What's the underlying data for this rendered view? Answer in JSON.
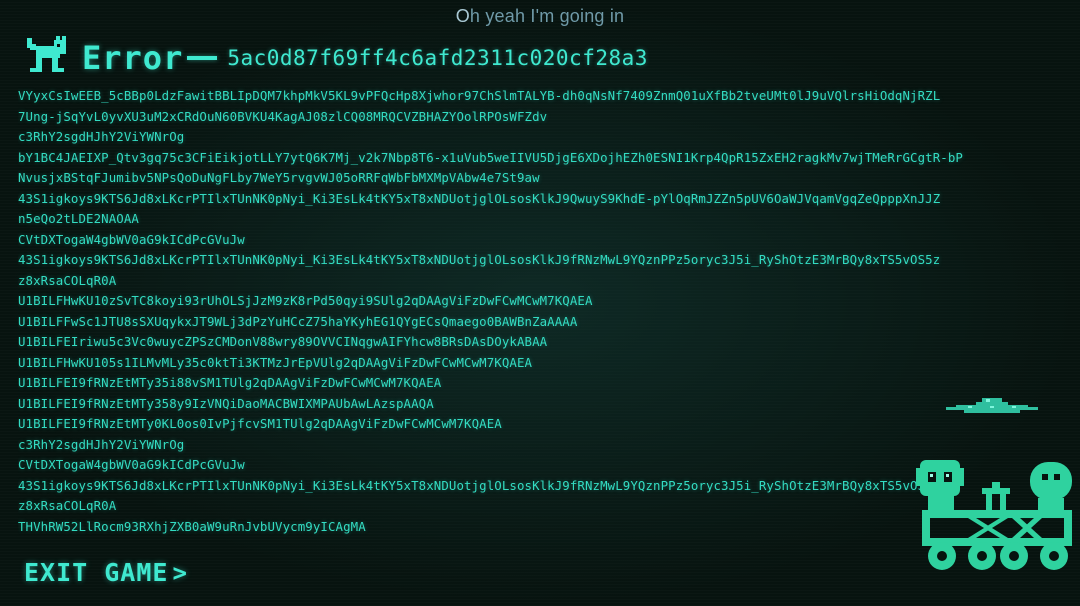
{
  "subtitle": {
    "first_letter": "O",
    "rest": "h yeah I'm going in"
  },
  "error": {
    "title": "Error",
    "hash": "5ac0d87f69ff4c6afd2311c020cf28a3"
  },
  "log_lines": [
    "VYyxCsIwEEB_5cBBp0LdzFawitBBLIpDQM7khpMkV5KL9vPFQcHp8Xjwhor97ChSlmTALYB-dh0qNsNf7409ZnmQ01uXfBb2tveUMt0lJ9uVQlrsHiOdqNjRZL",
    "7Ung-jSqYvL0yvXU3uM2xCRdOuN60BVKU4KagAJ08zlCQ08MRQCVZBHAZYOolRPOsWFZdv",
    "c3RhY2sgdHJhY2ViYWNrOg",
    "bY1BC4JAEIXP_Qtv3gq75c3CFiEikjotLLY7ytQ6K7Mj_v2k7Nbp8T6-x1uVub5weIIVU5DjgE6XDojhEZh0ESNI1Krp4QpR15ZxEH2ragkMv7wjTMeRrGCgtR-bP",
    "NvusjxBStqFJumibv5NPsQoDuNgFLby7WeY5rvgvWJ05oRRFqWbFbMXMpVAbw4e7St9aw",
    "43S1igkoys9KTS6Jd8xLKcrPTIlxTUnNK0pNyi_Ki3EsLk4tKY5xT8xNDUotjglOLsosKlkJ9QwuyS9KhdE-pYlOqRmJZZn5pUV6OaWJVqamVgqZeQpppXnJJZ",
    "n5eQo2tLDE2NAOAA",
    "CVtDXTogaW4gbWV0aG9kICdPcGVuJw",
    "43S1igkoys9KTS6Jd8xLKcrPTIlxTUnNK0pNyi_Ki3EsLk4tKY5xT8xNDUotjglOLsosKlkJ9fRNzMwL9YQznPPz5oryc3J5i_RyShOtzE3MrBQy8xTS5vOS5z",
    "z8xRsaCOLqR0A",
    "U1BILFHwKU10zSvTC8koyi93rUhOLSjJzM9zK8rPd50qyi9SUlg2qDAAgViFzDwFCwMCwM7KQAEA",
    "U1BILFFwSc1JTU8sSXUqykxJT9WLj3dPzYuHCcZ75haYKyhEG1QYgECsQmaego0BAWBnZaAAAA",
    "U1BILFEIriwu5c3Vc0wuycZPSzCMDonV88wry89OVVCINqgwAIFYhcw8BRsDAsDOykABAA",
    "U1BILFHwKU105s1ILMvMLy35c0ktTi3KTMzJrEpVUlg2qDAAgViFzDwFCwMCwM7KQAEA",
    "U1BILFEI9fRNzEtMTy35i88vSM1TUlg2qDAAgViFzDwFCwMCwM7KQAEA",
    "U1BILFEI9fRNzEtMTy358y9IzVNQiDaoMACBWIXMPAUbAwLAzspAAQA",
    "U1BILFEI9fRNzEtMTy0KL0os0IvPjfcvSM1TUlg2qDAAgViFzDwFCwMCwM7KQAEA",
    "c3RhY2sgdHJhY2ViYWNrOg",
    "CVtDXTogaW4gbWV0aG9kICdPcGVuJw",
    "43S1igkoys9KTS6Jd8xLKcrPTIlxTUnNK0pNyi_Ki3EsLk4tKY5xT8xNDUotjglOLsosKlkJ9fRNzMwL9YQznPPz5oryc3J5i_RyShOtzE3MrBQy8xTS5vOS5z",
    "z8xRsaCOLqR0A",
    "THVhRW52LlRocm93RXhjZXB0aW9uRnJvbUVycm9yICAgMA"
  ],
  "exit_button": {
    "label": "EXIT GAME",
    "chevron": ">"
  },
  "colors": {
    "accent": "#3fe9d0",
    "text": "#33dcc2",
    "background": "#07130f",
    "subtitle": "#6f9aa8"
  },
  "icons": {
    "mascot": "cat-mascot-icon",
    "ufo": "ufo-icon",
    "robots": "robots-on-cart-icon"
  }
}
